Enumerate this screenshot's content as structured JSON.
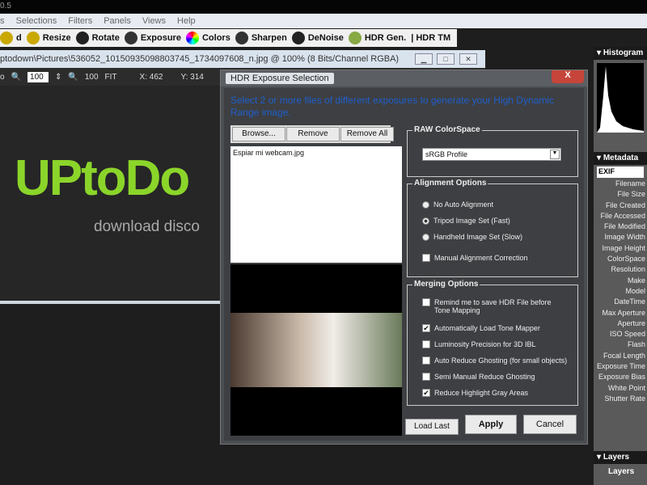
{
  "app": {
    "title_fragment": "0.5"
  },
  "menu": [
    "s",
    "Selections",
    "Filters",
    "Panels",
    "Views",
    "Help"
  ],
  "toolbar": [
    {
      "label": "d",
      "icon": "edit-icon"
    },
    {
      "label": "Resize",
      "icon": "resize-icon"
    },
    {
      "label": "Rotate",
      "icon": "rotate-icon"
    },
    {
      "label": "Exposure",
      "icon": "exposure-icon"
    },
    {
      "label": "Colors",
      "icon": "colors-icon"
    },
    {
      "label": "Sharpen",
      "icon": "sharpen-icon"
    },
    {
      "label": "DeNoise",
      "icon": "denoise-icon"
    },
    {
      "label": "HDR Gen.",
      "icon": "hdr-icon"
    },
    {
      "label": "|  HDR TM",
      "icon": ""
    }
  ],
  "document": {
    "title": "ptodown\\Pictures\\536052_10150935098803745_1734097608_n.jpg @ 100% (8 Bits/Channel RGBA)",
    "zoom": "100",
    "x_label": "X: 462",
    "y_label": "Y: 314",
    "z100": "100",
    "fit": "FIT",
    "prefix": "o"
  },
  "canvas": {
    "logo_text": "UPtoDo",
    "tagline": "download disco"
  },
  "right_panel": {
    "histogram": "Histogram",
    "metadata": "Metadata",
    "exif": "EXIF",
    "layers_header": "Layers",
    "layers_tab": "Layers",
    "fields": [
      "Filename",
      "File Size",
      "File Created",
      "File Accessed",
      "File Modified",
      "Image Width",
      "Image Height",
      "ColorSpace",
      "Resolution",
      "Make",
      "Model",
      "DateTime",
      "Max Aperture",
      "Aperture",
      "ISO Speed",
      "Flash",
      "Focal Length",
      "Exposure Time",
      "Exposure Bias",
      "White Point",
      "Shutter Rate"
    ]
  },
  "dialog": {
    "title": "HDR Exposure Selection",
    "close": "X",
    "instruction": "Select 2 or more files of different exposures to generate your High Dynamic Range image.",
    "browse": "Browse...",
    "remove": "Remove",
    "remove_all": "Remove All",
    "files": [
      "Espiar mi webcam.jpg"
    ],
    "raw_colorspace": {
      "label": "RAW ColorSpace",
      "value": "sRGB Profile"
    },
    "alignment": {
      "label": "Alignment Options",
      "options": [
        {
          "label": "No Auto Alignment",
          "selected": false
        },
        {
          "label": "Tripod Image Set (Fast)",
          "selected": true
        },
        {
          "label": "Handheld Image Set (Slow)",
          "selected": false
        }
      ],
      "manual": {
        "label": "Manual Alignment Correction",
        "checked": false
      }
    },
    "merging": {
      "label": "Merging Options",
      "options": [
        {
          "label": "Remind me to save HDR File before Tone Mapping",
          "checked": false
        },
        {
          "label": "Automatically Load Tone Mapper",
          "checked": true
        },
        {
          "label": "Luminosity Precision for 3D IBL",
          "checked": false
        },
        {
          "label": "Auto Reduce Ghosting (for small objects)",
          "checked": false
        },
        {
          "label": "Semi Manual Reduce Ghosting",
          "checked": false
        },
        {
          "label": "Reduce Highlight Gray Areas",
          "checked": true
        }
      ]
    },
    "load_last": "Load Last",
    "apply": "Apply",
    "cancel": "Cancel"
  }
}
